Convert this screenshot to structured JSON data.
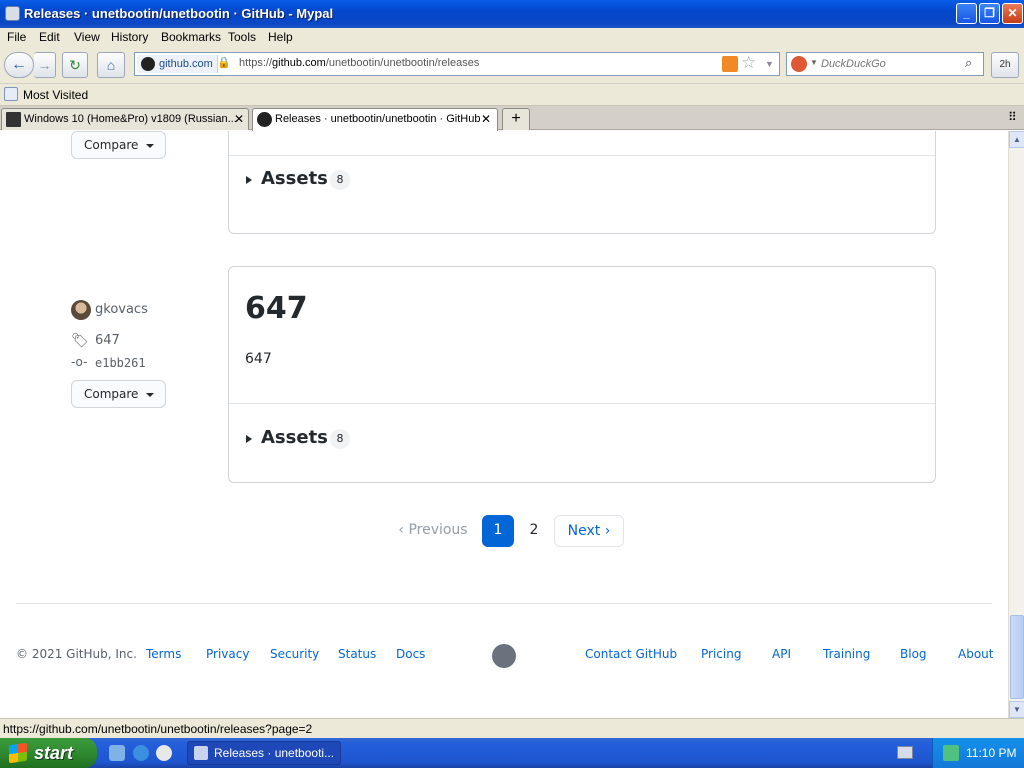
{
  "window": {
    "title": "Releases · unetbootin/unetbootin · GitHub - Mypal"
  },
  "menu": [
    "File",
    "Edit",
    "View",
    "History",
    "Bookmarks",
    "Tools",
    "Help"
  ],
  "address": {
    "site": "github.com",
    "url_prefix": "https://",
    "url_domain": "github.com",
    "url_path": "/unetbootin/unetbootin/releases"
  },
  "search": {
    "placeholder": "DuckDuckGo"
  },
  "toolbar": {
    "extra_label": "2h"
  },
  "bookmarks": {
    "most_visited": "Most Visited"
  },
  "tabs": [
    {
      "label": "Windows 10 (Home&Pro) v1809 (Russian..."
    },
    {
      "label": "Releases · unetbootin/unetbootin · GitHub"
    }
  ],
  "release_prev": {
    "compare": "Compare",
    "assets_label": "Assets",
    "assets_count": "8"
  },
  "release": {
    "author": "gkovacs",
    "tag": "647",
    "commit": "e1bb261",
    "compare": "Compare",
    "title": "647",
    "body": "647",
    "assets_label": "Assets",
    "assets_count": "8"
  },
  "pagination": {
    "previous": "Previous",
    "page1": "1",
    "page2": "2",
    "next": "Next"
  },
  "footer": {
    "copyright": "© 2021 GitHub, Inc.",
    "left_links": [
      "Terms",
      "Privacy",
      "Security",
      "Status",
      "Docs"
    ],
    "right_links": [
      "Contact GitHub",
      "Pricing",
      "API",
      "Training",
      "Blog",
      "About"
    ]
  },
  "status": {
    "text": "https://github.com/unetbootin/unetbootin/releases?page=2"
  },
  "taskbar": {
    "start": "start",
    "task": "Releases · unetbooti...",
    "clock": "11:10 PM"
  },
  "colors": {
    "accent": "#0366d6",
    "titlebar": "#0446cc",
    "link": "#0366d6"
  }
}
